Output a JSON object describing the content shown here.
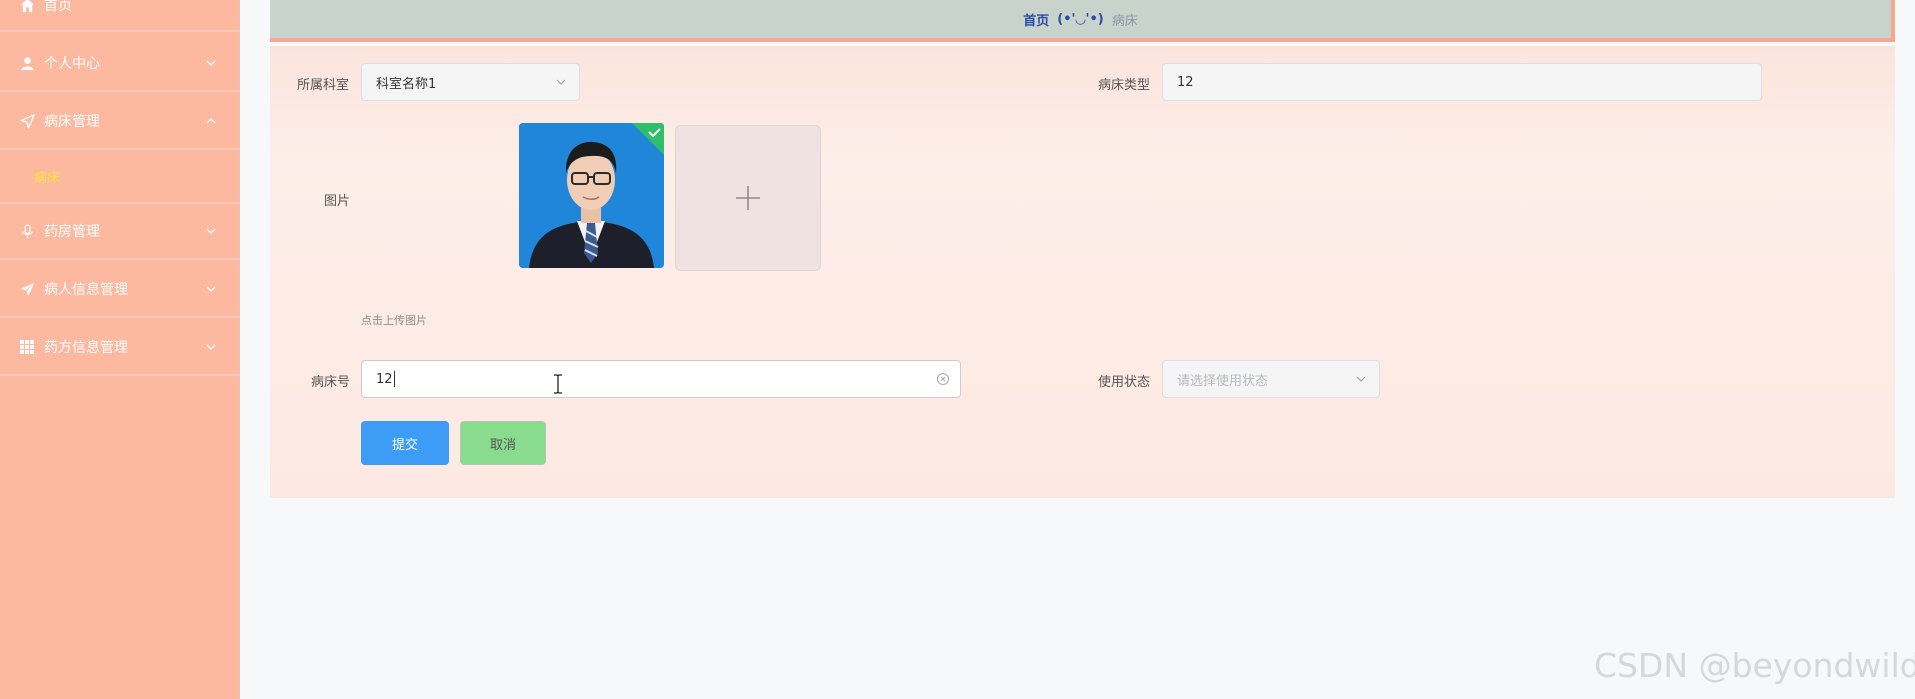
{
  "sidebar": {
    "items": [
      {
        "label": "首页",
        "icon": "home-icon"
      },
      {
        "label": "个人中心",
        "icon": "user-icon"
      },
      {
        "label": "病床管理",
        "icon": "navigation-icon",
        "expanded": true
      },
      {
        "label": "药房管理",
        "icon": "microphone-icon"
      },
      {
        "label": "病人信息管理",
        "icon": "send-icon"
      },
      {
        "label": "药方信息管理",
        "icon": "grid-icon"
      }
    ],
    "sub_items": [
      {
        "label": "病床"
      }
    ]
  },
  "breadcrumb": {
    "home": "首页",
    "separator": "(•'◡'•)",
    "current": "病床"
  },
  "form": {
    "department": {
      "label": "所属科室",
      "value": "科室名称1"
    },
    "bed_type": {
      "label": "病床类型",
      "value": "12"
    },
    "image": {
      "label": "图片",
      "hint": "点击上传图片"
    },
    "bed_number": {
      "label": "病床号",
      "value": "12"
    },
    "status": {
      "label": "使用状态",
      "placeholder": "请选择使用状态"
    },
    "submit_label": "提交",
    "cancel_label": "取消"
  },
  "watermark": "CSDN @beyondwild",
  "colors": {
    "sidebar_bg": "#fdb8a0",
    "active_sub": "#f7e53b",
    "primary": "#3d9cf6",
    "cancel": "#89dc8e",
    "breadcrumb_home": "#2b4aa8"
  }
}
